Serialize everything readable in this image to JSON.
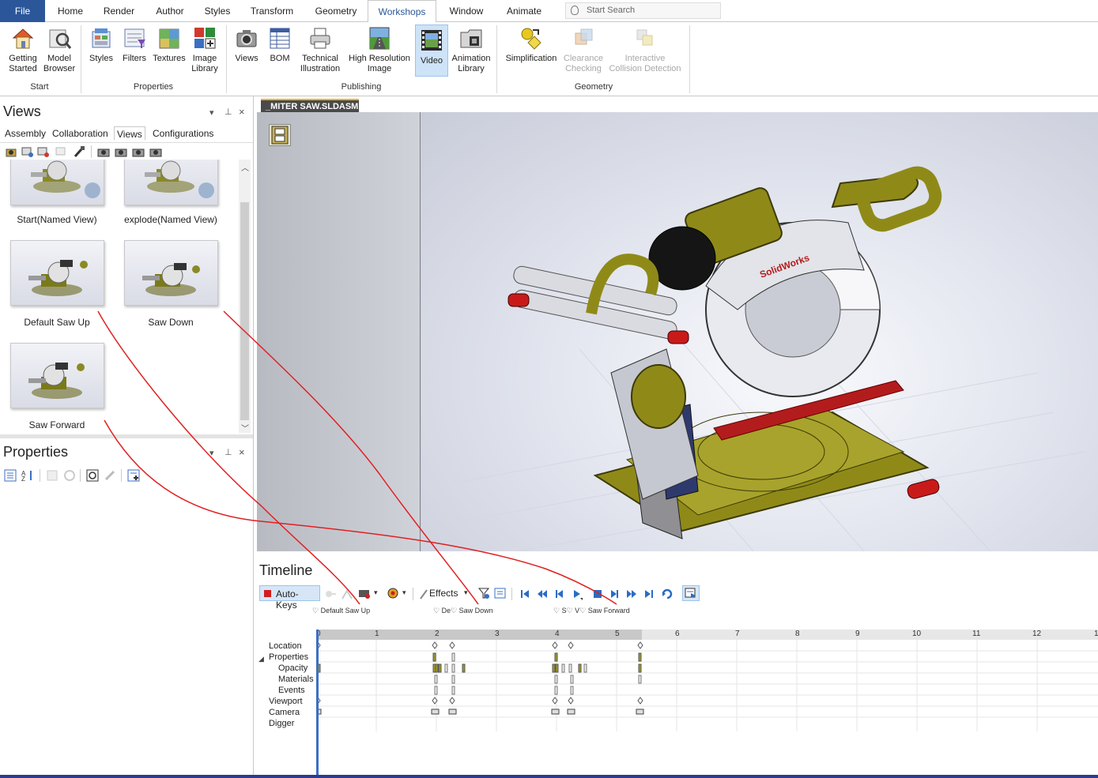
{
  "tabs": {
    "file": "File",
    "items": [
      "Home",
      "Render",
      "Author",
      "Styles",
      "Transform",
      "Geometry",
      "Workshops",
      "Window",
      "Animate"
    ],
    "active": "Workshops",
    "search_placeholder": "Start Search"
  },
  "ribbon": {
    "groups": {
      "start": {
        "label": "Start",
        "buttons": [
          {
            "line1": "Getting",
            "line2": "Started",
            "icon": "house-icon"
          },
          {
            "line1": "Model",
            "line2": "Browser",
            "icon": "model-browser-icon"
          }
        ]
      },
      "properties": {
        "label": "Properties",
        "buttons": [
          {
            "line1": "Styles",
            "line2": "",
            "icon": "styles-icon"
          },
          {
            "line1": "Filters",
            "line2": "",
            "icon": "filters-icon"
          },
          {
            "line1": "Textures",
            "line2": "",
            "icon": "textures-icon"
          },
          {
            "line1": "Image",
            "line2": "Library",
            "icon": "image-library-icon"
          }
        ]
      },
      "publishing": {
        "label": "Publishing",
        "buttons": [
          {
            "line1": "Views",
            "line2": "",
            "icon": "camera-icon"
          },
          {
            "line1": "BOM",
            "line2": "",
            "icon": "bom-icon"
          },
          {
            "line1": "Technical",
            "line2": "Illustration",
            "icon": "printer-icon"
          },
          {
            "line1": "High Resolution",
            "line2": "Image",
            "icon": "road-image-icon"
          },
          {
            "line1": "Video",
            "line2": "",
            "icon": "film-icon"
          },
          {
            "line1": "Animation",
            "line2": "Library",
            "icon": "animation-library-icon"
          }
        ]
      },
      "geometry": {
        "label": "Geometry",
        "buttons": [
          {
            "line1": "Simplification",
            "line2": "",
            "icon": "simplification-icon"
          },
          {
            "line1": "Clearance",
            "line2": "Checking",
            "icon": "clearance-icon"
          },
          {
            "line1": "Interactive",
            "line2": "Collision Detection",
            "icon": "collision-icon"
          }
        ]
      }
    }
  },
  "views_panel": {
    "title": "Views",
    "tabs": [
      "Assembly",
      "Collaboration",
      "Views",
      "Configurations"
    ],
    "active_tab": "Views",
    "thumbnails": [
      {
        "label": "Start(Named View)"
      },
      {
        "label": "explode(Named View)"
      },
      {
        "label": "Default Saw Up"
      },
      {
        "label": "Saw Down"
      },
      {
        "label": "Saw Forward"
      }
    ]
  },
  "properties_panel": {
    "title": "Properties"
  },
  "document": {
    "tab": "_MITER SAW.SLDASM",
    "watermark": "SolidWorks"
  },
  "timeline": {
    "title": "Timeline",
    "auto_keys": "Auto-Keys",
    "effects": "Effects",
    "markers": [
      {
        "text": "♡ Default Saw Up"
      },
      {
        "text": "♡ De♡ Saw Down"
      },
      {
        "text": "♡ S♡ V♡ Saw Forward"
      }
    ],
    "ruler_ticks": [
      "0",
      "1",
      "2",
      "3",
      "4",
      "5",
      "6",
      "7",
      "8",
      "9",
      "10",
      "11",
      "12",
      "1"
    ],
    "rows": [
      "Location",
      "Properties",
      "Opacity",
      "Materials",
      "Events",
      "Viewport",
      "Camera",
      "Digger"
    ]
  },
  "colors": {
    "accent": "#2b579a",
    "selected": "#cde3f7",
    "annotation": "#e02020"
  }
}
